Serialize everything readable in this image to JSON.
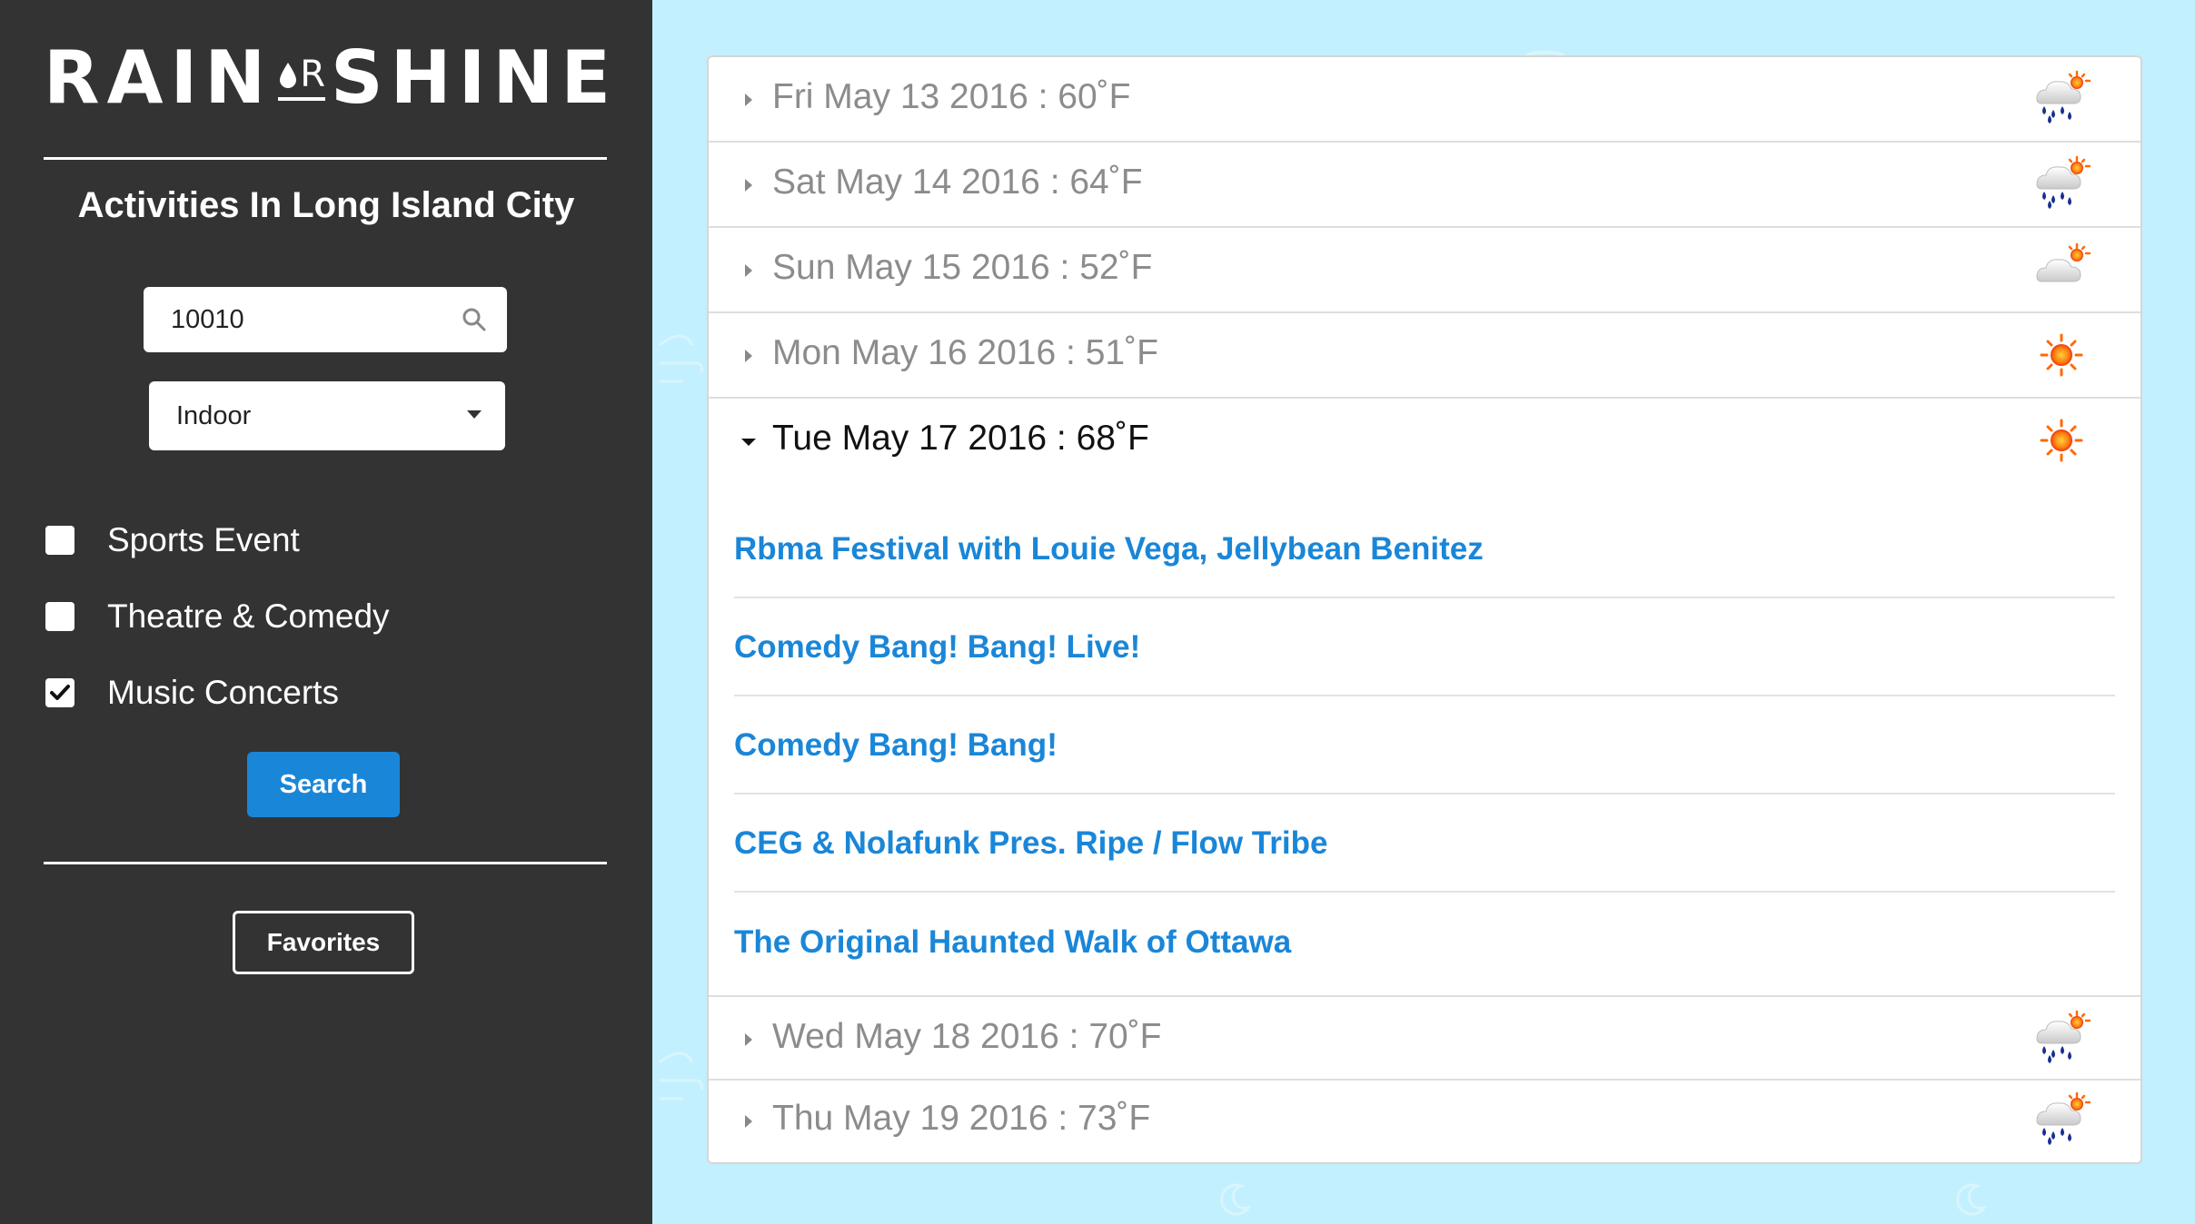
{
  "brand": {
    "left": "RAIN",
    "or": "R",
    "right": "SHINE"
  },
  "sidebar": {
    "title": "Activities In Long Island City",
    "zip_value": "10010",
    "setting_selected": "Indoor",
    "categories": [
      {
        "label": "Sports Event",
        "checked": false
      },
      {
        "label": "Theatre & Comedy",
        "checked": false
      },
      {
        "label": "Music Concerts",
        "checked": true
      }
    ],
    "search_label": "Search",
    "favorites_label": "Favorites"
  },
  "days": [
    {
      "label": "Fri May 13 2016 : 60˚F",
      "weather": "rain-sun-icon",
      "open": false
    },
    {
      "label": "Sat May 14 2016 : 64˚F",
      "weather": "rain-sun-icon",
      "open": false
    },
    {
      "label": "Sun May 15 2016 : 52˚F",
      "weather": "cloud-sun-icon",
      "open": false
    },
    {
      "label": "Mon May 16 2016 : 51˚F",
      "weather": "sun-icon",
      "open": false
    },
    {
      "label": "Tue May 17 2016 : 68˚F",
      "weather": "sun-icon",
      "open": true
    },
    {
      "label": "Wed May 18 2016 : 70˚F",
      "weather": "rain-sun-icon",
      "open": false
    },
    {
      "label": "Thu May 19 2016 : 73˚F",
      "weather": "rain-sun-icon",
      "open": false
    }
  ],
  "events": [
    "Rbma Festival with Louie Vega, Jellybean Benitez",
    "Comedy Bang! Bang! Live!",
    "Comedy Bang! Bang!",
    "CEG & Nolafunk Pres. Ripe / Flow Tribe",
    "The Original Haunted Walk of Ottawa"
  ],
  "colors": {
    "sidebar_bg": "#333333",
    "page_bg": "#c3f0fe",
    "accent_blue": "#1a86d8"
  }
}
